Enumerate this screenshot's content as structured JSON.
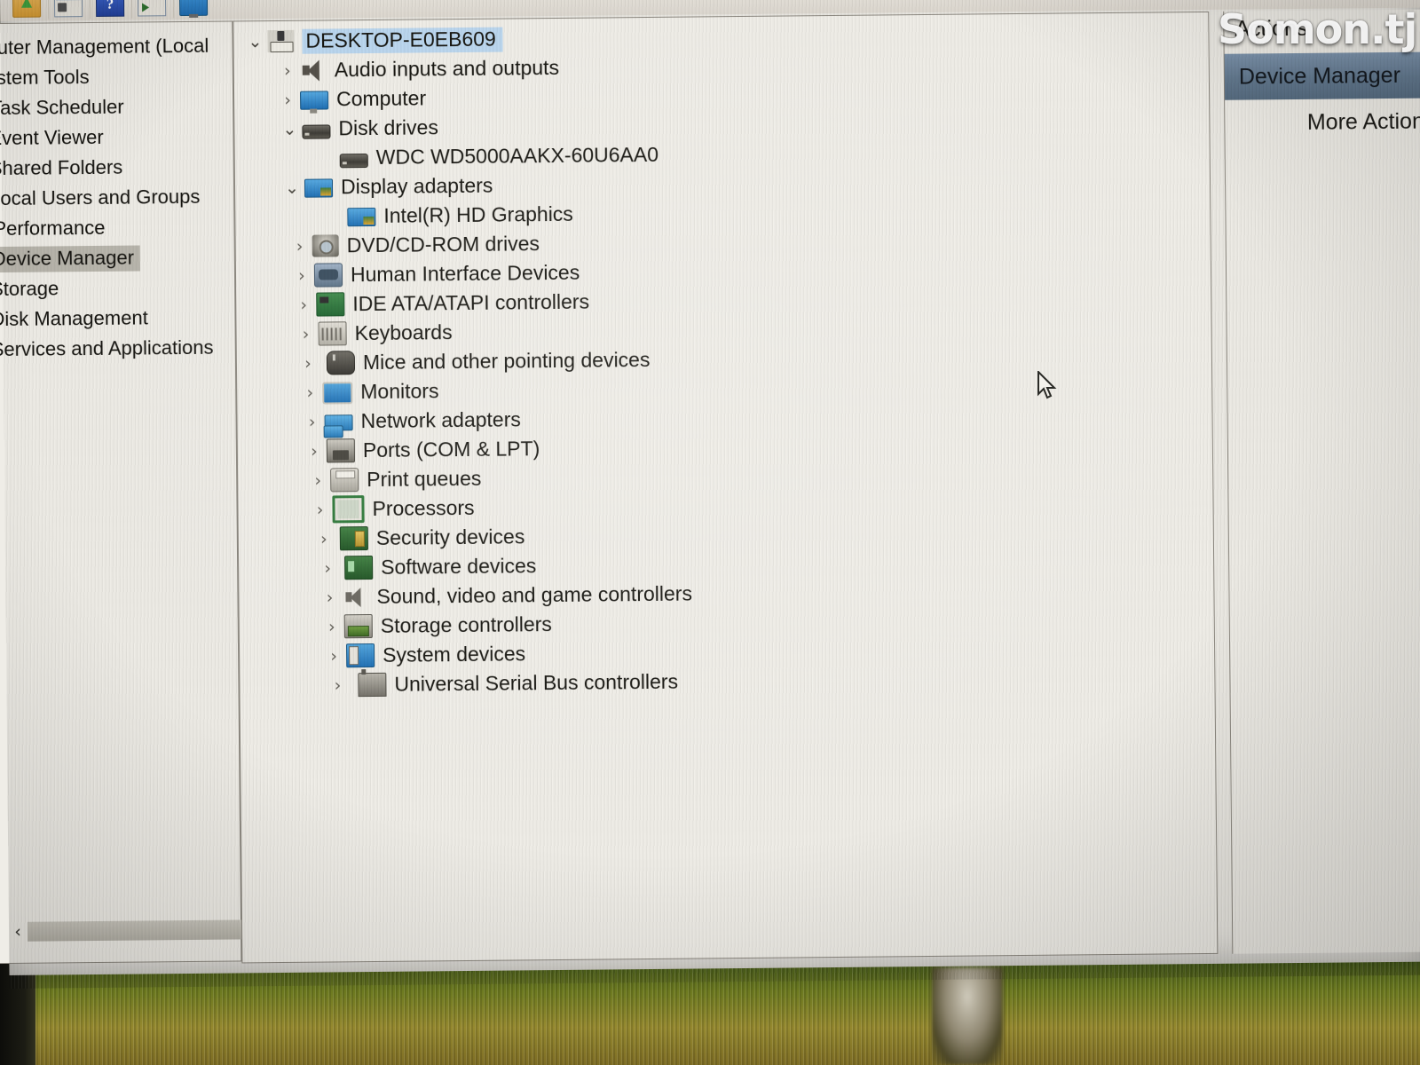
{
  "watermark": "Somon.tj",
  "toolbar": {
    "buttons": [
      {
        "name": "up-one-level-icon",
        "label": "Up One Level"
      },
      {
        "name": "show-hide-console-tree-icon",
        "label": "Show/Hide Console Tree"
      },
      {
        "name": "help-icon",
        "label": "Help"
      },
      {
        "name": "show-hide-action-pane-icon",
        "label": "Show/Hide Action Pane"
      },
      {
        "name": "properties-icon",
        "label": "Properties"
      }
    ]
  },
  "console_tree": {
    "items": [
      {
        "label": "puter Management (Local",
        "icon": "console-root-icon",
        "level": 0,
        "selected": false,
        "clipped": true
      },
      {
        "label": "ystem Tools",
        "icon": "system-tools-icon",
        "level": 0,
        "selected": false,
        "clipped": true
      },
      {
        "label": "Task Scheduler",
        "icon": "clock-icon",
        "level": 1,
        "selected": false
      },
      {
        "label": "Event Viewer",
        "icon": "event-viewer-icon",
        "level": 1,
        "selected": false
      },
      {
        "label": "Shared Folders",
        "icon": "shared-folders-icon",
        "level": 1,
        "selected": false
      },
      {
        "label": "Local Users and Groups",
        "icon": "users-group-icon",
        "level": 1,
        "selected": false
      },
      {
        "label": "Performance",
        "icon": "performance-icon",
        "level": 1,
        "selected": false
      },
      {
        "label": "Device Manager",
        "icon": "device-manager-icon",
        "level": 1,
        "selected": true
      },
      {
        "label": "Storage",
        "icon": "storage-icon",
        "level": 0,
        "selected": false
      },
      {
        "label": "Disk Management",
        "icon": "disk-management-icon",
        "level": 1,
        "selected": false
      },
      {
        "label": "Services and Applications",
        "icon": "services-icon",
        "level": 0,
        "selected": false
      }
    ],
    "scrollbar": {
      "left_arrow": "‹",
      "right_arrow": "›"
    }
  },
  "device_tree": {
    "items": [
      {
        "label": "DESKTOP-E0EB609",
        "icon": "computer-root-icon",
        "level": 0,
        "state": "expanded",
        "selected": true
      },
      {
        "label": "Audio inputs and outputs",
        "icon": "speaker-icon",
        "level": 1,
        "state": "collapsed",
        "selected": false
      },
      {
        "label": "Computer",
        "icon": "computer-icon",
        "level": 1,
        "state": "collapsed",
        "selected": false
      },
      {
        "label": "Disk drives",
        "icon": "disk-drive-icon",
        "level": 1,
        "state": "expanded",
        "selected": false
      },
      {
        "label": "WDC WD5000AAKX-60U6AA0",
        "icon": "disk-drive-icon",
        "level": 2,
        "state": "leaf",
        "selected": false
      },
      {
        "label": "Display adapters",
        "icon": "display-adapter-icon",
        "level": 1,
        "state": "expanded",
        "selected": false
      },
      {
        "label": "Intel(R) HD Graphics",
        "icon": "display-adapter-icon",
        "level": 2,
        "state": "leaf",
        "selected": false
      },
      {
        "label": "DVD/CD-ROM drives",
        "icon": "dvd-drive-icon",
        "level": 1,
        "state": "collapsed",
        "selected": false
      },
      {
        "label": "Human Interface Devices",
        "icon": "hid-icon",
        "level": 1,
        "state": "collapsed",
        "selected": false
      },
      {
        "label": "IDE ATA/ATAPI controllers",
        "icon": "ide-controller-icon",
        "level": 1,
        "state": "collapsed",
        "selected": false
      },
      {
        "label": "Keyboards",
        "icon": "keyboard-icon",
        "level": 1,
        "state": "collapsed",
        "selected": false
      },
      {
        "label": "Mice and other pointing devices",
        "icon": "mouse-icon",
        "level": 1,
        "state": "collapsed",
        "selected": false
      },
      {
        "label": "Monitors",
        "icon": "monitor-icon",
        "level": 1,
        "state": "collapsed",
        "selected": false
      },
      {
        "label": "Network adapters",
        "icon": "network-adapter-icon",
        "level": 1,
        "state": "collapsed",
        "selected": false
      },
      {
        "label": "Ports (COM & LPT)",
        "icon": "port-icon",
        "level": 1,
        "state": "collapsed",
        "selected": false
      },
      {
        "label": "Print queues",
        "icon": "printer-icon",
        "level": 1,
        "state": "collapsed",
        "selected": false
      },
      {
        "label": "Processors",
        "icon": "processor-icon",
        "level": 1,
        "state": "collapsed",
        "selected": false
      },
      {
        "label": "Security devices",
        "icon": "security-device-icon",
        "level": 1,
        "state": "collapsed",
        "selected": false
      },
      {
        "label": "Software devices",
        "icon": "software-device-icon",
        "level": 1,
        "state": "collapsed",
        "selected": false
      },
      {
        "label": "Sound, video and game controllers",
        "icon": "sound-controller-icon",
        "level": 1,
        "state": "collapsed",
        "selected": false
      },
      {
        "label": "Storage controllers",
        "icon": "storage-controller-icon",
        "level": 1,
        "state": "collapsed",
        "selected": false
      },
      {
        "label": "System devices",
        "icon": "system-device-icon",
        "level": 1,
        "state": "collapsed",
        "selected": false
      },
      {
        "label": "Universal Serial Bus controllers",
        "icon": "usb-controller-icon",
        "level": 1,
        "state": "collapsed",
        "selected": false
      }
    ],
    "chevron_collapsed": "›",
    "chevron_expanded": "⌄"
  },
  "actions_pane": {
    "title": "Actions",
    "selected_item": "Device Manager",
    "more_actions": "More Actions"
  },
  "colors": {
    "selection_blue": "#bcd8f0",
    "selection_gray": "#b9b6ad",
    "actions_band": "#63798f",
    "window_bg": "#efede7"
  }
}
